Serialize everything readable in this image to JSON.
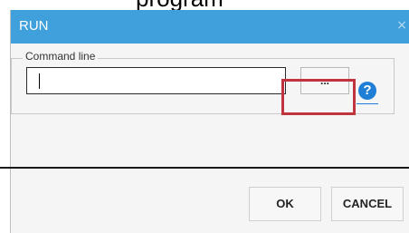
{
  "background_text": "program",
  "dialog": {
    "title": "RUN",
    "close_symbol": "×",
    "group_label": "Command line",
    "command_value": "",
    "browse_label": "...",
    "help_symbol": "?",
    "ok_label": "OK",
    "cancel_label": "CANCEL"
  },
  "colors": {
    "titlebar": "#3fa0dc",
    "highlight_box": "#c0343d",
    "help_icon": "#1f7fd6"
  },
  "icons": [
    "close-icon",
    "help-icon"
  ]
}
